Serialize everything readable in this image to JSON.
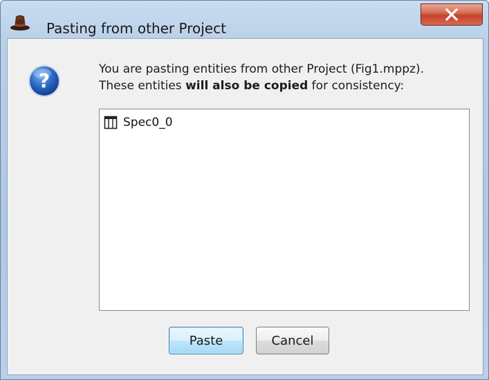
{
  "window": {
    "title": "Pasting from other Project",
    "close_icon": "close-x-icon"
  },
  "dialog": {
    "icon": "question-icon",
    "message_line1": "You are pasting entities from other Project (Fig1.mppz).",
    "message_line2_prefix": "These entities ",
    "message_line2_bold": "will also be copied",
    "message_line2_suffix": " for consistency:"
  },
  "list": {
    "items": [
      {
        "icon": "table-icon",
        "label": "Spec0_0"
      }
    ]
  },
  "buttons": {
    "paste_label": "Paste",
    "cancel_label": "Cancel"
  }
}
